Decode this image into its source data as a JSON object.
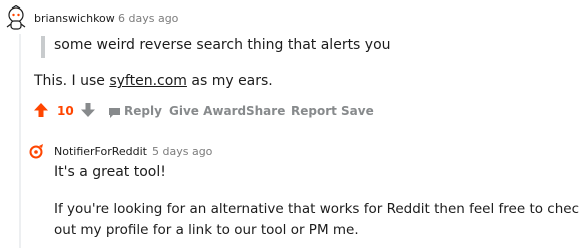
{
  "comment1": {
    "username": "brianswichkow",
    "time": "6 days ago",
    "quote": "some weird reverse search thing that alerts you",
    "text_before_link": "This. I use ",
    "link_text": "syften.com",
    "text_after_link": " as my ears.",
    "score": "10",
    "actions": {
      "reply": "Reply",
      "give_award": "Give Award",
      "share": "Share",
      "report": "Report",
      "save": "Save"
    },
    "avatar_icon": "snoo-avatar-icon"
  },
  "comment2": {
    "username": "NotifierForReddit",
    "time": "5 days ago",
    "para1": "It's a great tool!",
    "para2_line1": "If you're looking for an alternative that works for Reddit then feel free to check",
    "para2_line2": "out my profile for a link to our tool or PM me.",
    "avatar_icon": "notifier-logo-icon"
  },
  "colors": {
    "upvote": "#ff4500",
    "score": "#ff4500",
    "muted": "#878a8c",
    "thread_line": "#edeff1"
  }
}
